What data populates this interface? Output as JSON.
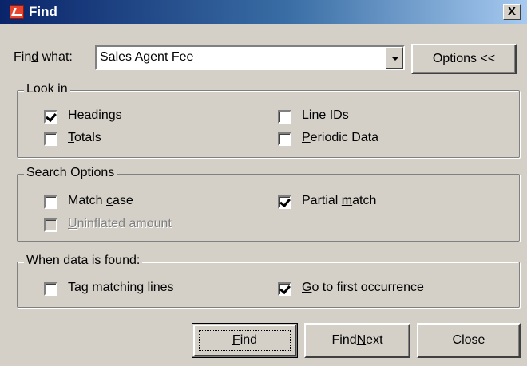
{
  "window": {
    "title": "Find",
    "close_glyph": "X",
    "icon": "app-icon"
  },
  "find_what": {
    "label_pre": "Fin",
    "label_key": "d",
    "label_post": " what:",
    "value": "Sales Agent Fee"
  },
  "buttons": {
    "options": "Options <<",
    "find_key": "F",
    "find_post": "ind",
    "find_next_pre": "Find ",
    "find_next_key": "N",
    "find_next_post": "ext",
    "close": "Close"
  },
  "look_in": {
    "legend": "Look in",
    "headings": {
      "key": "H",
      "rest": "eadings",
      "checked": true
    },
    "totals": {
      "key": "T",
      "rest": "otals",
      "checked": false
    },
    "line_ids": {
      "key": "L",
      "rest": "ine IDs",
      "checked": false
    },
    "periodic": {
      "key": "P",
      "rest": "eriodic Data",
      "checked": false
    }
  },
  "search_options": {
    "legend": "Search Options",
    "match_case": {
      "pre": "Match ",
      "key": "c",
      "post": "ase",
      "checked": false
    },
    "uninflated": {
      "key": "U",
      "rest": "ninflated amount",
      "checked": false,
      "disabled": true
    },
    "partial": {
      "pre": "Partial ",
      "key": "m",
      "post": "atch",
      "checked": true
    }
  },
  "when_found": {
    "legend": "When data is found:",
    "tag": {
      "pre": "Ta",
      "key": "g",
      "post": " matching lines",
      "checked": false
    },
    "goto": {
      "key": "G",
      "rest": "o to first occurrence",
      "checked": true
    }
  }
}
